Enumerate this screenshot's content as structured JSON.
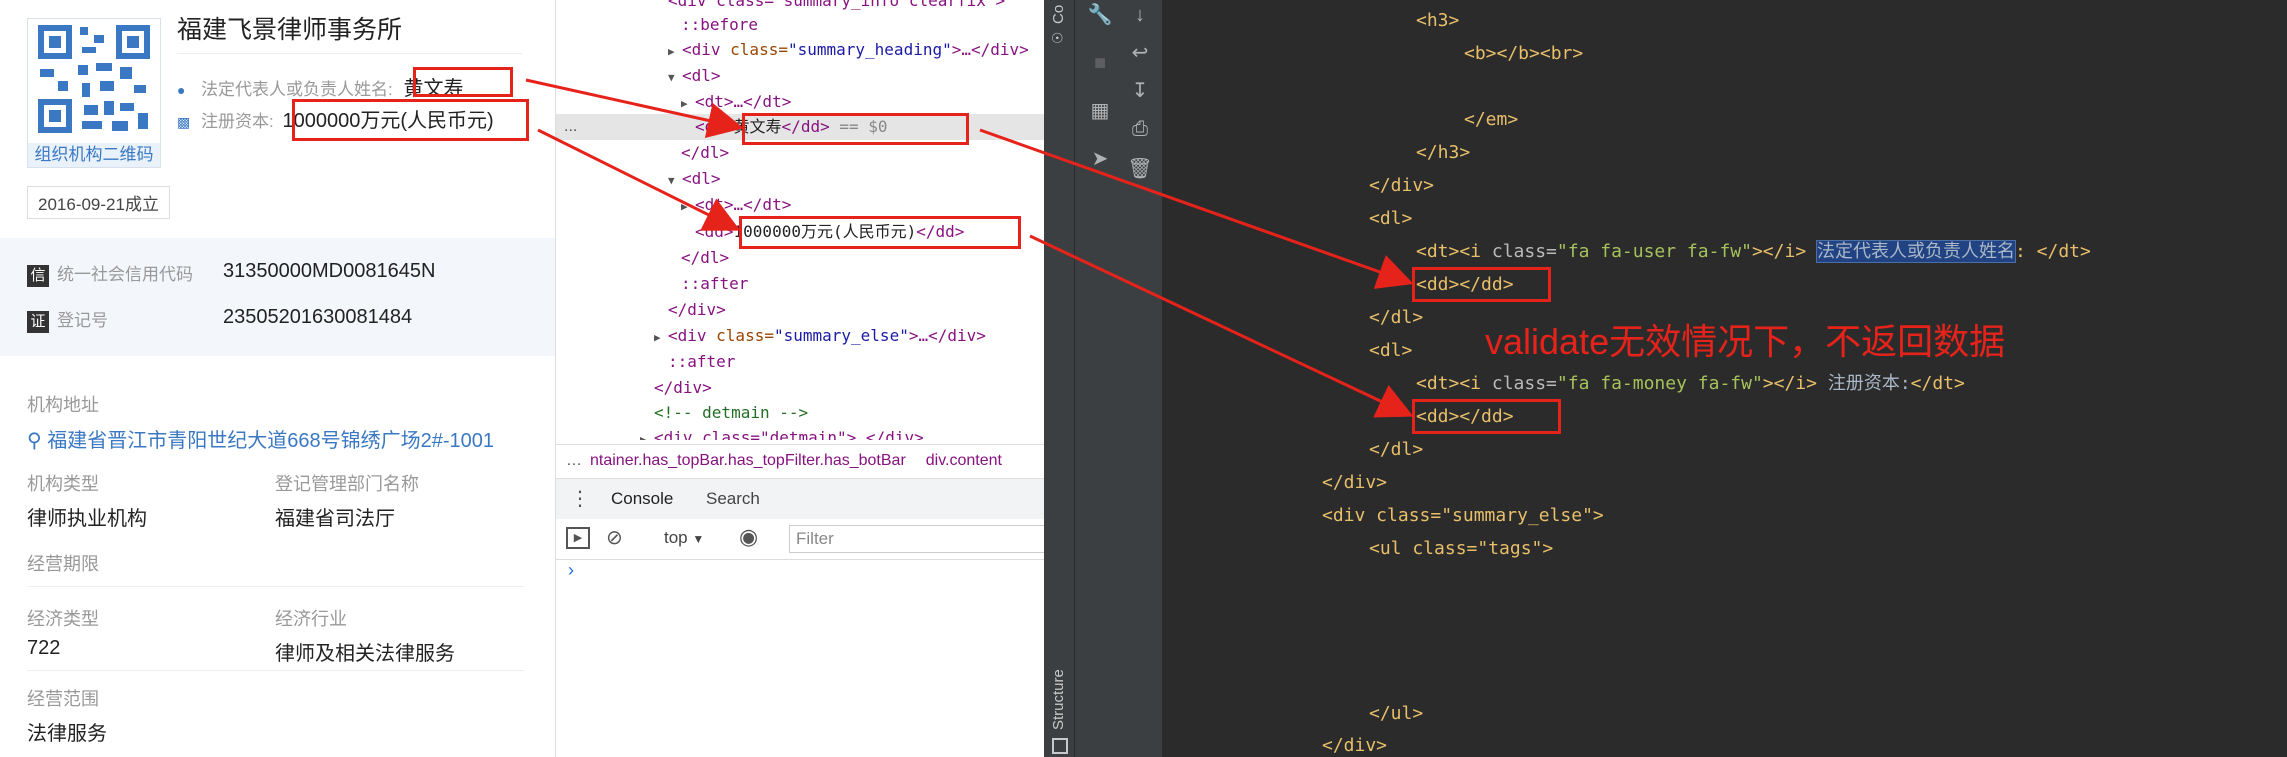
{
  "left": {
    "qr_label": "组织机构二维码",
    "company_name": "福建飞景律师事务所",
    "rep_label": "法定代表人或负责人姓名:",
    "rep_value": "黄文寿",
    "capital_label": "注册资本:",
    "capital_value": "1000000万元(人民币元)",
    "founded": "2016-09-21成立",
    "credit_badge": "信",
    "credit_label": "统一社会信用代码",
    "credit_value": "31350000MD0081645N",
    "reg_badge": "证",
    "reg_label": "登记号",
    "reg_value": "23505201630081484",
    "addr_label": "机构地址",
    "addr_value": "福建省晋江市青阳世纪大道668号锦绣广场2#-1001",
    "type_label": "机构类型",
    "type_value": "律师执业机构",
    "dept_label": "登记管理部门名称",
    "dept_value": "福建省司法厅",
    "term_label": "经营期限",
    "econ_type_label": "经济类型",
    "econ_type_value": "722",
    "industry_label": "经济行业",
    "industry_value": "律师及相关法律服务",
    "scope_label": "经营范围",
    "scope_value": "法律服务"
  },
  "devtools": {
    "dom": {
      "l0": "<div class=\"summary_info clearfix\">",
      "l1": "::before",
      "l2_open": "<div",
      "l2_attr": " class=",
      "l2_val": "\"summary_heading\"",
      "l2_close": ">…</div>",
      "l3": "<dl>",
      "l4": "<dt>…</dt>",
      "l5_dd": "<dd>",
      "l5_text": "黄文寿",
      "l5_end": "</dd>",
      "l5_eq": " == $0",
      "l6": "</dl>",
      "l7": "<dl>",
      "l8": "<dt>…</dt>",
      "l9_text": "1000000万元(人民币元)",
      "l10": "</dl>",
      "l11": "::after",
      "l12": "</div>",
      "l13_open": "<div",
      "l13_attr": " class=",
      "l13_val": "\"summary_else\"",
      "l13_close": ">…</div>",
      "l14": "::after",
      "l15": "</div>",
      "l16": "<!-- detmain -->",
      "l17": "<div class=\"detmain\">…</div>",
      "ellipsis": "..."
    },
    "crumb1": "ntainer.has_topBar.has_topFilter.has_botBar",
    "crumb2": "div.content",
    "tab_console": "Console",
    "tab_search": "Search",
    "context": "top",
    "filter_placeholder": "Filter",
    "prompt": "›"
  },
  "ide": {
    "gutter_label": "Co",
    "structure_label": "Structure"
  },
  "editor": {
    "lines": [
      "<h3>",
      "<b></b><br>",
      "</em>",
      "</h3>",
      "</div>",
      "<dl>",
      "<dd></dd>",
      "</dl>",
      "<dl>",
      "<dd></dd>",
      "</dl>",
      "</div>",
      "<div class=\"summary_else\">",
      "<ul class=\"tags\">",
      "</ul>",
      "</div>"
    ],
    "dt1_pre": "<dt><i ",
    "dt1_attr": "class=",
    "dt1_val": "\"fa fa-user fa-fw\"",
    "dt1_mid": "></i> ",
    "dt1_hl": "法定代表人或负责人姓名",
    "dt1_end": ": </dt>",
    "dt2_pre": "<dt><i ",
    "dt2_attr": "class=",
    "dt2_val": "\"fa fa-money fa-fw\"",
    "dt2_mid": "></i> ",
    "dt2_text": "注册资本:",
    "dt2_end": "</dt>"
  },
  "annotation": {
    "text": "validate无效情况下，不返回数据",
    "color": "#e5231b"
  }
}
